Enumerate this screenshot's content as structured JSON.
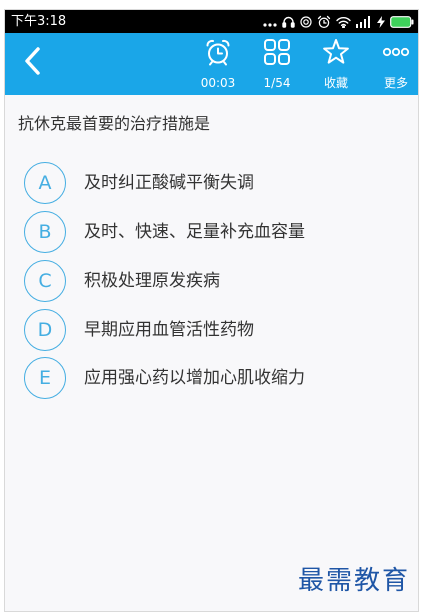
{
  "status_bar": {
    "time": "下午3:18",
    "icons": [
      "more-dots-icon",
      "headphones-icon",
      "circle-status-icon",
      "alarm-icon",
      "wifi-icon",
      "signal-icon",
      "charging-icon",
      "battery-icon"
    ]
  },
  "toolbar": {
    "back_icon": "chevron-left-icon",
    "items": [
      {
        "icon": "alarm-clock-icon",
        "label": "00:03"
      },
      {
        "icon": "grid-icon",
        "label": "1/54"
      },
      {
        "icon": "star-icon",
        "label": "收藏"
      },
      {
        "icon": "more-circles-icon",
        "label": "更多"
      }
    ]
  },
  "question": {
    "text": "抗休克最首要的治疗措施是",
    "options": [
      {
        "letter": "A",
        "text": "及时纠正酸碱平衡失调"
      },
      {
        "letter": "B",
        "text": "及时、快速、足量补充血容量"
      },
      {
        "letter": "C",
        "text": "积极处理原发疾病"
      },
      {
        "letter": "D",
        "text": "早期应用血管活性药物"
      },
      {
        "letter": "E",
        "text": "应用强心药以增加心肌收缩力"
      }
    ]
  },
  "watermark": {
    "text": "最需教育"
  },
  "colors": {
    "statusbar": "#000000",
    "toolbar": "#1aa6e8",
    "circle": "#45aee2",
    "text": "#333333",
    "watermark": "#1f56a6",
    "battery": "#3fd05b"
  }
}
